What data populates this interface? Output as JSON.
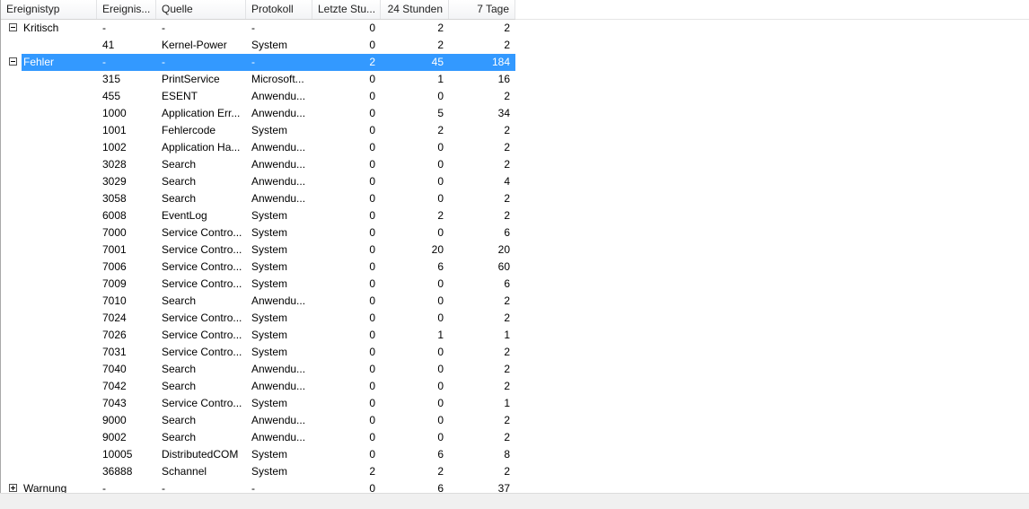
{
  "columns": [
    {
      "label": "Ereignistyp"
    },
    {
      "label": "Ereignis..."
    },
    {
      "label": "Quelle"
    },
    {
      "label": "Protokoll"
    },
    {
      "label": "Letzte Stu..."
    },
    {
      "label": "24 Stunden"
    },
    {
      "label": "7 Tage"
    }
  ],
  "groups": [
    {
      "label": "Kritisch",
      "expanded": true,
      "id": "-",
      "source": "-",
      "log": "-",
      "last_hour": "0",
      "h24": "2",
      "d7": "2",
      "items": [
        {
          "id": "41",
          "source": "Kernel-Power",
          "log": "System",
          "last_hour": "0",
          "h24": "2",
          "d7": "2"
        }
      ]
    },
    {
      "label": "Fehler",
      "expanded": true,
      "selected": true,
      "id": "-",
      "source": "-",
      "log": "-",
      "last_hour": "2",
      "h24": "45",
      "d7": "184",
      "items": [
        {
          "id": "315",
          "source": "PrintService",
          "log": "Microsoft...",
          "last_hour": "0",
          "h24": "1",
          "d7": "16"
        },
        {
          "id": "455",
          "source": "ESENT",
          "log": "Anwendu...",
          "last_hour": "0",
          "h24": "0",
          "d7": "2"
        },
        {
          "id": "1000",
          "source": "Application Err...",
          "log": "Anwendu...",
          "last_hour": "0",
          "h24": "5",
          "d7": "34"
        },
        {
          "id": "1001",
          "source": "Fehlercode",
          "log": "System",
          "last_hour": "0",
          "h24": "2",
          "d7": "2"
        },
        {
          "id": "1002",
          "source": "Application Ha...",
          "log": "Anwendu...",
          "last_hour": "0",
          "h24": "0",
          "d7": "2"
        },
        {
          "id": "3028",
          "source": "Search",
          "log": "Anwendu...",
          "last_hour": "0",
          "h24": "0",
          "d7": "2"
        },
        {
          "id": "3029",
          "source": "Search",
          "log": "Anwendu...",
          "last_hour": "0",
          "h24": "0",
          "d7": "4"
        },
        {
          "id": "3058",
          "source": "Search",
          "log": "Anwendu...",
          "last_hour": "0",
          "h24": "0",
          "d7": "2"
        },
        {
          "id": "6008",
          "source": "EventLog",
          "log": "System",
          "last_hour": "0",
          "h24": "2",
          "d7": "2"
        },
        {
          "id": "7000",
          "source": "Service Contro...",
          "log": "System",
          "last_hour": "0",
          "h24": "0",
          "d7": "6"
        },
        {
          "id": "7001",
          "source": "Service Contro...",
          "log": "System",
          "last_hour": "0",
          "h24": "20",
          "d7": "20"
        },
        {
          "id": "7006",
          "source": "Service Contro...",
          "log": "System",
          "last_hour": "0",
          "h24": "6",
          "d7": "60"
        },
        {
          "id": "7009",
          "source": "Service Contro...",
          "log": "System",
          "last_hour": "0",
          "h24": "0",
          "d7": "6"
        },
        {
          "id": "7010",
          "source": "Search",
          "log": "Anwendu...",
          "last_hour": "0",
          "h24": "0",
          "d7": "2"
        },
        {
          "id": "7024",
          "source": "Service Contro...",
          "log": "System",
          "last_hour": "0",
          "h24": "0",
          "d7": "2"
        },
        {
          "id": "7026",
          "source": "Service Contro...",
          "log": "System",
          "last_hour": "0",
          "h24": "1",
          "d7": "1"
        },
        {
          "id": "7031",
          "source": "Service Contro...",
          "log": "System",
          "last_hour": "0",
          "h24": "0",
          "d7": "2"
        },
        {
          "id": "7040",
          "source": "Search",
          "log": "Anwendu...",
          "last_hour": "0",
          "h24": "0",
          "d7": "2"
        },
        {
          "id": "7042",
          "source": "Search",
          "log": "Anwendu...",
          "last_hour": "0",
          "h24": "0",
          "d7": "2"
        },
        {
          "id": "7043",
          "source": "Service Contro...",
          "log": "System",
          "last_hour": "0",
          "h24": "0",
          "d7": "1"
        },
        {
          "id": "9000",
          "source": "Search",
          "log": "Anwendu...",
          "last_hour": "0",
          "h24": "0",
          "d7": "2"
        },
        {
          "id": "9002",
          "source": "Search",
          "log": "Anwendu...",
          "last_hour": "0",
          "h24": "0",
          "d7": "2"
        },
        {
          "id": "10005",
          "source": "DistributedCOM",
          "log": "System",
          "last_hour": "0",
          "h24": "6",
          "d7": "8"
        },
        {
          "id": "36888",
          "source": "Schannel",
          "log": "System",
          "last_hour": "2",
          "h24": "2",
          "d7": "2"
        }
      ]
    },
    {
      "label": "Warnung",
      "expanded": false,
      "id": "-",
      "source": "-",
      "log": "-",
      "last_hour": "0",
      "h24": "6",
      "d7": "37",
      "items": []
    }
  ],
  "icons": {
    "collapse": "minus-box-icon",
    "expand": "plus-box-icon"
  },
  "colors": {
    "selection": "#3399ff",
    "selection_text": "#ffffff"
  }
}
